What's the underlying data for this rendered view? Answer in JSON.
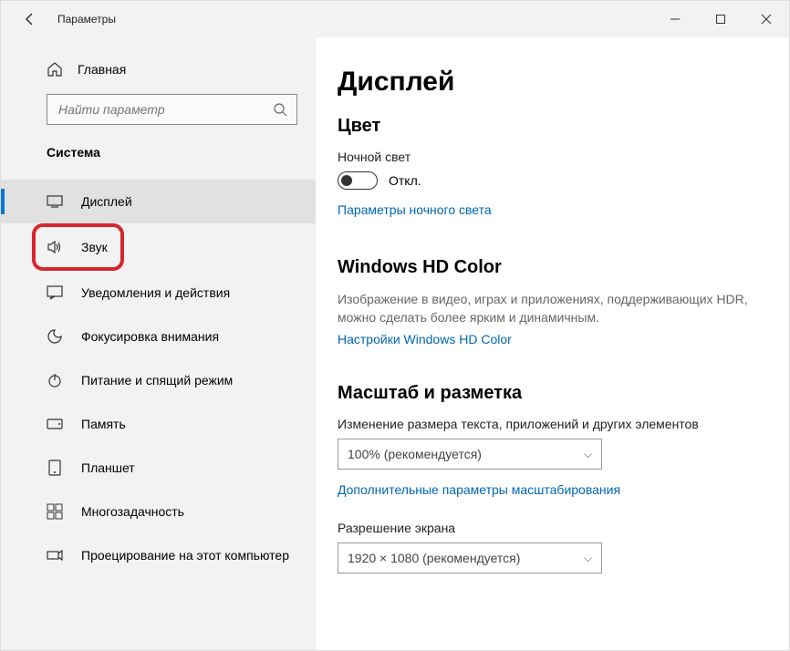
{
  "window": {
    "title": "Параметры"
  },
  "sidebar": {
    "home": "Главная",
    "search_placeholder": "Найти параметр",
    "category": "Система",
    "items": [
      {
        "label": "Дисплей",
        "icon": "display"
      },
      {
        "label": "Звук",
        "icon": "sound"
      },
      {
        "label": "Уведомления и действия",
        "icon": "notifications"
      },
      {
        "label": "Фокусировка внимания",
        "icon": "focus"
      },
      {
        "label": "Питание и спящий режим",
        "icon": "power"
      },
      {
        "label": "Память",
        "icon": "storage"
      },
      {
        "label": "Планшет",
        "icon": "tablet"
      },
      {
        "label": "Многозадачность",
        "icon": "multitask"
      },
      {
        "label": "Проецирование на этот компьютер",
        "icon": "project"
      }
    ]
  },
  "main": {
    "page_title": "Дисплей",
    "color": {
      "heading": "Цвет",
      "night_light_label": "Ночной свет",
      "toggle_state": "Откл.",
      "night_light_settings": "Параметры ночного света"
    },
    "hdcolor": {
      "heading": "Windows HD Color",
      "desc": "Изображение в видео, играх и приложениях, поддерживающих HDR, можно сделать более ярким и динамичным.",
      "link": "Настройки Windows HD Color"
    },
    "scale": {
      "heading": "Масштаб и разметка",
      "scale_label": "Изменение размера текста, приложений и других элементов",
      "scale_value": "100% (рекомендуется)",
      "advanced_scaling": "Дополнительные параметры масштабирования",
      "resolution_label": "Разрешение экрана",
      "resolution_value": "1920 × 1080 (рекомендуется)"
    }
  }
}
